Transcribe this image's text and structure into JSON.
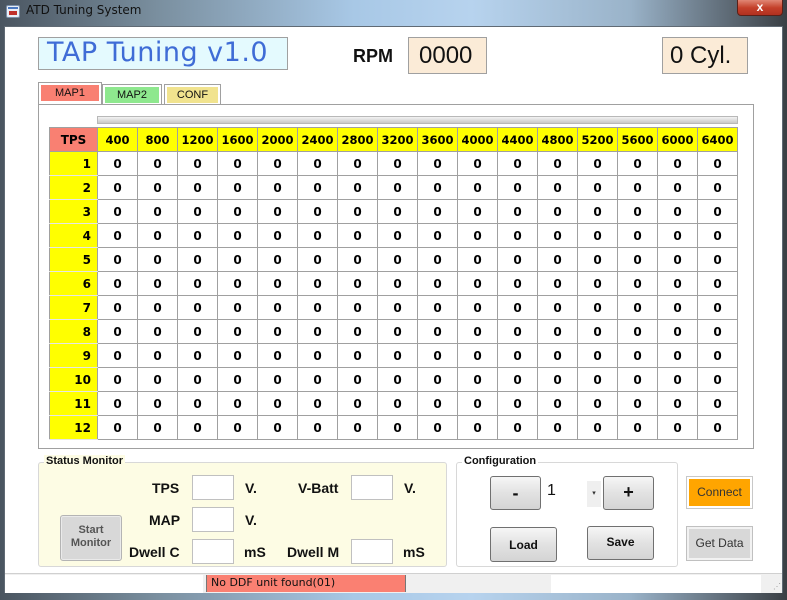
{
  "window": {
    "title": "ATD Tuning System",
    "close_glyph": "x"
  },
  "header": {
    "app_title": "TAP Tuning v1.0",
    "rpm_label": "RPM",
    "rpm_value": "0000",
    "cyl_value": "0 Cyl."
  },
  "tabs": [
    {
      "label": "MAP1",
      "active": true,
      "color": "#f98072"
    },
    {
      "label": "MAP2",
      "active": false,
      "color": "#8ee88e"
    },
    {
      "label": "CONF",
      "active": false,
      "color": "#f1e38e"
    }
  ],
  "map_table": {
    "corner_label": "TPS",
    "columns": [
      "400",
      "800",
      "1200",
      "1600",
      "2000",
      "2400",
      "2800",
      "3200",
      "3600",
      "4000",
      "4400",
      "4800",
      "5200",
      "5600",
      "6000",
      "6400"
    ],
    "rows": [
      {
        "label": "1",
        "values": [
          "0",
          "0",
          "0",
          "0",
          "0",
          "0",
          "0",
          "0",
          "0",
          "0",
          "0",
          "0",
          "0",
          "0",
          "0",
          "0"
        ]
      },
      {
        "label": "2",
        "values": [
          "0",
          "0",
          "0",
          "0",
          "0",
          "0",
          "0",
          "0",
          "0",
          "0",
          "0",
          "0",
          "0",
          "0",
          "0",
          "0"
        ]
      },
      {
        "label": "3",
        "values": [
          "0",
          "0",
          "0",
          "0",
          "0",
          "0",
          "0",
          "0",
          "0",
          "0",
          "0",
          "0",
          "0",
          "0",
          "0",
          "0"
        ]
      },
      {
        "label": "4",
        "values": [
          "0",
          "0",
          "0",
          "0",
          "0",
          "0",
          "0",
          "0",
          "0",
          "0",
          "0",
          "0",
          "0",
          "0",
          "0",
          "0"
        ]
      },
      {
        "label": "5",
        "values": [
          "0",
          "0",
          "0",
          "0",
          "0",
          "0",
          "0",
          "0",
          "0",
          "0",
          "0",
          "0",
          "0",
          "0",
          "0",
          "0"
        ]
      },
      {
        "label": "6",
        "values": [
          "0",
          "0",
          "0",
          "0",
          "0",
          "0",
          "0",
          "0",
          "0",
          "0",
          "0",
          "0",
          "0",
          "0",
          "0",
          "0"
        ]
      },
      {
        "label": "7",
        "values": [
          "0",
          "0",
          "0",
          "0",
          "0",
          "0",
          "0",
          "0",
          "0",
          "0",
          "0",
          "0",
          "0",
          "0",
          "0",
          "0"
        ]
      },
      {
        "label": "8",
        "values": [
          "0",
          "0",
          "0",
          "0",
          "0",
          "0",
          "0",
          "0",
          "0",
          "0",
          "0",
          "0",
          "0",
          "0",
          "0",
          "0"
        ]
      },
      {
        "label": "9",
        "values": [
          "0",
          "0",
          "0",
          "0",
          "0",
          "0",
          "0",
          "0",
          "0",
          "0",
          "0",
          "0",
          "0",
          "0",
          "0",
          "0"
        ]
      },
      {
        "label": "10",
        "values": [
          "0",
          "0",
          "0",
          "0",
          "0",
          "0",
          "0",
          "0",
          "0",
          "0",
          "0",
          "0",
          "0",
          "0",
          "0",
          "0"
        ]
      },
      {
        "label": "11",
        "values": [
          "0",
          "0",
          "0",
          "0",
          "0",
          "0",
          "0",
          "0",
          "0",
          "0",
          "0",
          "0",
          "0",
          "0",
          "0",
          "0"
        ]
      },
      {
        "label": "12",
        "values": [
          "0",
          "0",
          "0",
          "0",
          "0",
          "0",
          "0",
          "0",
          "0",
          "0",
          "0",
          "0",
          "0",
          "0",
          "0",
          "0"
        ]
      }
    ]
  },
  "status_monitor": {
    "title": "Status Monitor",
    "start_button": "Start Monitor",
    "tps_label": "TPS",
    "tps_value": "",
    "tps_unit": "V.",
    "vbatt_label": "V-Batt",
    "vbatt_value": "",
    "vbatt_unit": "V.",
    "map_label": "MAP",
    "map_value": "",
    "map_unit": "V.",
    "dwellc_label": "Dwell C",
    "dwellc_value": "",
    "dwellc_unit": "mS",
    "dwellm_label": "Dwell M",
    "dwellm_value": "",
    "dwellm_unit": "mS"
  },
  "configuration": {
    "title": "Configuration",
    "minus_label": "-",
    "plus_label": "+",
    "value": "1",
    "dropdown_glyph": "▾",
    "load_label": "Load",
    "save_label": "Save"
  },
  "actions": {
    "connect_label": "Connect",
    "connect_color": "#ffa500",
    "get_data_label": "Get Data"
  },
  "statusbar": {
    "message": "No DDF unit found(01)",
    "message_color": "#fa8072",
    "grip_glyph": "⋰"
  }
}
